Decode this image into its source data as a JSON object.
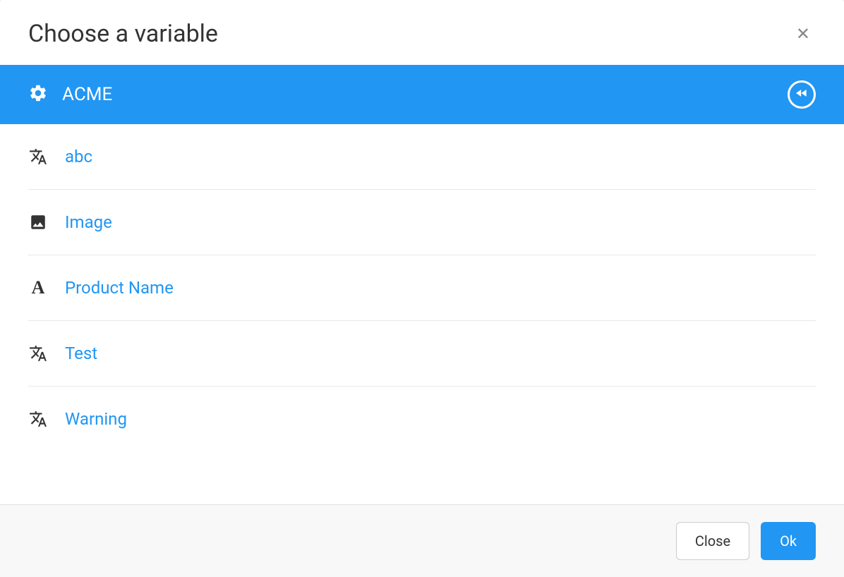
{
  "modal": {
    "title": "Choose a variable",
    "category": "ACME"
  },
  "items": [
    {
      "label": "abc",
      "icon": "translate"
    },
    {
      "label": "Image",
      "icon": "image"
    },
    {
      "label": "Product Name",
      "icon": "font"
    },
    {
      "label": "Test",
      "icon": "translate"
    },
    {
      "label": "Warning",
      "icon": "translate"
    }
  ],
  "buttons": {
    "close": "Close",
    "ok": "Ok"
  }
}
